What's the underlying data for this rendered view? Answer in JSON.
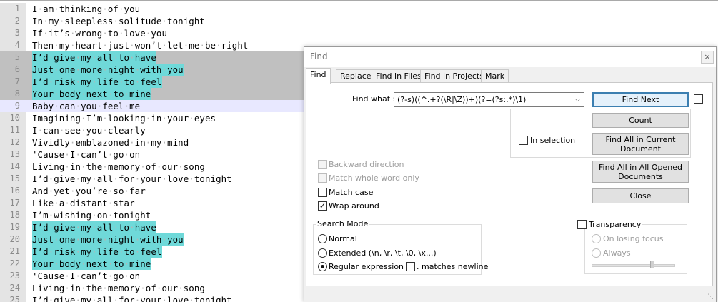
{
  "editor": {
    "lines": [
      {
        "n": "1",
        "text": "I am thinking of you",
        "state": "normal"
      },
      {
        "n": "2",
        "text": "In my sleepless solitude tonight",
        "state": "normal"
      },
      {
        "n": "3",
        "text": "If it’s wrong to love you",
        "state": "normal"
      },
      {
        "n": "4",
        "text": "Then my heart just won’t let me be right",
        "state": "normal"
      },
      {
        "n": "5",
        "text": "I’d give my all to have",
        "state": "hl-sel"
      },
      {
        "n": "6",
        "text": "Just one more night with you",
        "state": "hl-sel"
      },
      {
        "n": "7",
        "text": "I’d risk my life to feel",
        "state": "hl-sel"
      },
      {
        "n": "8",
        "text": "Your body next to mine",
        "state": "hl-sel"
      },
      {
        "n": "9",
        "text": "Baby can you feel me",
        "state": "current"
      },
      {
        "n": "10",
        "text": "Imagining I’m looking in your eyes",
        "state": "normal"
      },
      {
        "n": "11",
        "text": "I can see you clearly",
        "state": "normal"
      },
      {
        "n": "12",
        "text": "Vividly emblazoned in my mind",
        "state": "normal"
      },
      {
        "n": "13",
        "text": "'Cause I can’t go on",
        "state": "normal"
      },
      {
        "n": "14",
        "text": "Living in the memory of our song",
        "state": "normal"
      },
      {
        "n": "15",
        "text": "I’d give my all for your love tonight",
        "state": "normal"
      },
      {
        "n": "16",
        "text": "And yet you’re so far",
        "state": "normal"
      },
      {
        "n": "17",
        "text": "Like a distant star",
        "state": "normal"
      },
      {
        "n": "18",
        "text": "I’m wishing on tonight",
        "state": "normal"
      },
      {
        "n": "19",
        "text": "I’d give my all to have",
        "state": "hl"
      },
      {
        "n": "20",
        "text": "Just one more night with you",
        "state": "hl"
      },
      {
        "n": "21",
        "text": "I’d risk my life to feel",
        "state": "hl"
      },
      {
        "n": "22",
        "text": "Your body next to mine",
        "state": "hl"
      },
      {
        "n": "23",
        "text": "'Cause I can’t go on",
        "state": "normal"
      },
      {
        "n": "24",
        "text": "Living in the memory of our song",
        "state": "normal"
      },
      {
        "n": "25",
        "text": "I’d give my all for your love tonight",
        "state": "normal"
      }
    ],
    "colors": {
      "highlight": "#6fd9d9",
      "selection": "#c0c0c0",
      "current_line": "#e8e8ff"
    }
  },
  "dialog": {
    "title": "Find",
    "close_glyph": "×",
    "tabs": [
      "Find",
      "Replace",
      "Find in Files",
      "Find in Projects",
      "Mark"
    ],
    "active_tab": "Find",
    "find_what_label": "Find what :",
    "find_what_value": "(?-s)((^.+?(\\R|\\Z))+)(?=(?s:.*)\\1)",
    "buttons": {
      "find_next": "Find Next",
      "count": "Count",
      "find_all_current": "Find All in Current Document",
      "find_all_opened": "Find All in All Opened Documents",
      "close": "Close"
    },
    "in_selection": {
      "label": "In selection",
      "checked": false
    },
    "options": {
      "backward": {
        "label": "Backward direction",
        "checked": false,
        "enabled": false
      },
      "whole_word": {
        "label": "Match whole word only",
        "checked": false,
        "enabled": false
      },
      "match_case": {
        "label": "Match case",
        "checked": false,
        "enabled": true
      },
      "wrap_around": {
        "label": "Wrap around",
        "checked": true,
        "enabled": true
      }
    },
    "search_mode": {
      "title": "Search Mode",
      "normal": "Normal",
      "extended": "Extended (\\n, \\r, \\t, \\0, \\x...)",
      "regex": "Regular expression",
      "matches_newline": ". matches newline",
      "selected": "regex"
    },
    "transparency": {
      "label": "Transparency",
      "checked": false,
      "on_losing_focus": "On losing focus",
      "always": "Always"
    }
  }
}
